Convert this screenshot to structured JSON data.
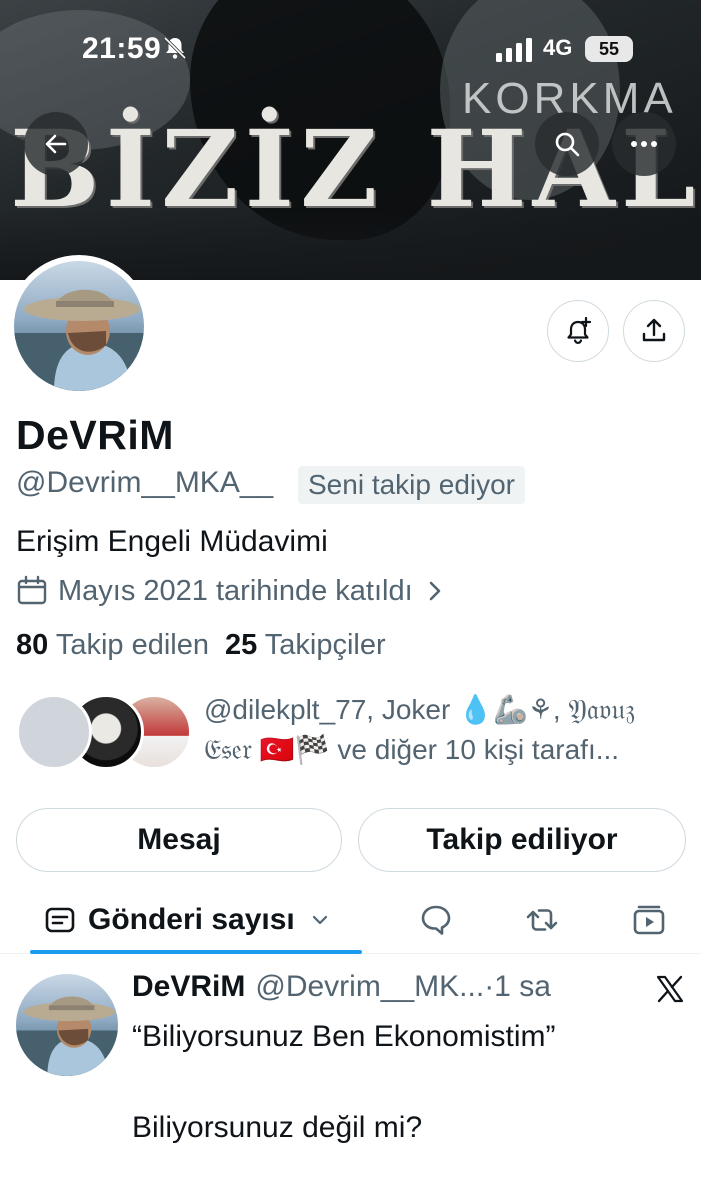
{
  "status_bar": {
    "time": "21:59",
    "network": "4G",
    "battery": "55"
  },
  "banner": {
    "headline": "BİZİZ HALK",
    "subtext": "KORKMA",
    "colors": {
      "background": "#1d2124",
      "text": "#e8e6e1"
    }
  },
  "profile": {
    "name": "DeVRiM",
    "handle": "@Devrim__MKA__",
    "follows_you": "Seni takip ediyor",
    "bio": "Erişim Engeli Müdavimi",
    "joined": "Mayıs 2021 tarihinde katıldı",
    "following_count": "80",
    "following_label": "Takip edilen",
    "followers_count": "25",
    "followers_label": "Takipçiler"
  },
  "followers_you_know": {
    "line1": "@dilekplt_77, Joker 💧🦾⚘, 𝔜𝔞𝔳𝔲𝔷",
    "line2": "𝔈𝔰𝔢𝔯 🇹🇷🏁 ve diğer 10 kişi tarafı..."
  },
  "buttons": {
    "message": "Mesaj",
    "following": "Takip ediliyor"
  },
  "tabs": {
    "posts": "Gönderi sayısı"
  },
  "icons": {
    "back": "arrow-left-icon",
    "search": "search-icon",
    "more": "more-icon",
    "notify": "bell-plus-icon",
    "share": "share-icon",
    "calendar": "calendar-icon",
    "replies": "chat-bubble-icon",
    "reposts": "repost-icon",
    "media": "media-icon",
    "x_logo": "x-logo-icon"
  },
  "post": {
    "name": "DeVRiM",
    "handle": "@Devrim__MK...",
    "time": "·1 sa",
    "line1": "“Biliyorsunuz Ben Ekonomistim”",
    "line2": "Biliyorsunuz değil mi?"
  },
  "colors": {
    "accent": "#1d9bf0",
    "secondary_text": "#536471",
    "border": "#cfd9de"
  }
}
